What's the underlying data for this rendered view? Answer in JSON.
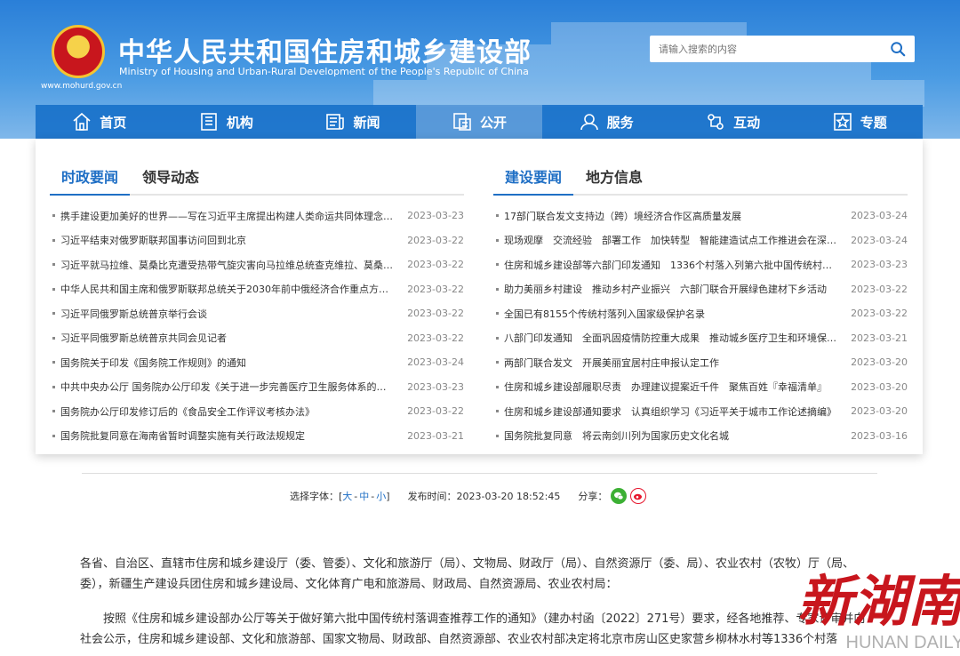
{
  "header": {
    "title_cn": "中华人民共和国住房和城乡建设部",
    "title_en": "Ministry of Housing and Urban-Rural Development of the People's Republic of China",
    "site_url": "www.mohurd.gov.cn"
  },
  "search": {
    "placeholder": "请输入搜索的内容"
  },
  "nav": [
    "首页",
    "机构",
    "新闻",
    "公开",
    "服务",
    "互动",
    "专题"
  ],
  "left": {
    "tabs": [
      "时政要闻",
      "领导动态"
    ],
    "items": [
      {
        "title": "携手建设更加美好的世界——写在习近平主席提出构建人类命运共同体理念十周年之际",
        "date": "2023-03-23"
      },
      {
        "title": "习近平结束对俄罗斯联邦国事访问回到北京",
        "date": "2023-03-22"
      },
      {
        "title": "习近平就马拉维、莫桑比克遭受热带气旋灾害向马拉维总统查克维拉、莫桑比克总统纽西致慰问电",
        "date": "2023-03-22"
      },
      {
        "title": "中华人民共和国主席和俄罗斯联邦总统关于2030年前中俄经济合作重点方向发展规划的联合声明",
        "date": "2023-03-22"
      },
      {
        "title": "习近平同俄罗斯总统普京举行会谈",
        "date": "2023-03-22"
      },
      {
        "title": "习近平同俄罗斯总统普京共同会见记者",
        "date": "2023-03-22"
      },
      {
        "title": "国务院关于印发《国务院工作规则》的通知",
        "date": "2023-03-24"
      },
      {
        "title": "中共中央办公厅 国务院办公厅印发《关于进一步完善医疗卫生服务体系的意见》",
        "date": "2023-03-23"
      },
      {
        "title": "国务院办公厅印发修订后的《食品安全工作评议考核办法》",
        "date": "2023-03-22"
      },
      {
        "title": "国务院批复同意在海南省暂时调整实施有关行政法规规定",
        "date": "2023-03-21"
      }
    ]
  },
  "right": {
    "tabs": [
      "建设要闻",
      "地方信息"
    ],
    "items": [
      {
        "title": "17部门联合发文支持边（跨）境经济合作区高质量发展",
        "date": "2023-03-24"
      },
      {
        "title": "现场观摩　交流经验　部署工作　加快转型　智能建造试点工作推进会在深圳召开",
        "date": "2023-03-24"
      },
      {
        "title": "住房和城乡建设部等六部门印发通知　1336个村落入列第六批中国传统村落名录",
        "date": "2023-03-23"
      },
      {
        "title": "助力美丽乡村建设　推动乡村产业振兴　六部门联合开展绿色建材下乡活动",
        "date": "2023-03-22"
      },
      {
        "title": "全国已有8155个传统村落列入国家级保护名录",
        "date": "2023-03-22"
      },
      {
        "title": "八部门印发通知　全面巩固疫情防控重大成果　推动城乡医疗卫生和环境保护工作补短板强弱项",
        "date": "2023-03-21"
      },
      {
        "title": "两部门联合发文　开展美丽宜居村庄申报认定工作",
        "date": "2023-03-20"
      },
      {
        "title": "住房和城乡建设部履职尽责　办理建议提案近千件　聚焦百姓『幸福清单』",
        "date": "2023-03-20"
      },
      {
        "title": "住房和城乡建设部通知要求　认真组织学习《习近平关于城市工作论述摘编》",
        "date": "2023-03-20"
      },
      {
        "title": "国务院批复同意　将云南剑川列为国家历史文化名城",
        "date": "2023-03-16"
      }
    ]
  },
  "meta": {
    "font_label": "选择字体：[",
    "font_large": "大",
    "sep1": "-",
    "font_medium": "中",
    "sep2": "-",
    "font_small": "小",
    "font_end": "]",
    "time_label": "发布时间：2023-03-20 18:52:45",
    "share_label": "分享："
  },
  "body": {
    "p1": "各省、自治区、直辖市住房和城乡建设厅（委、管委）、文化和旅游厅（局）、文物局、财政厅（局）、自然资源厅（委、局）、农业农村（农牧）厅（局、委），新疆生产建设兵团住房和城乡建设局、文化体育广电和旅游局、财政局、自然资源局、农业农村局：",
    "p2": "按照《住房和城乡建设部办公厅等关于做好第六批中国传统村落调查推荐工作的通知》（建办村函〔2022〕271号）要求，经各地推荐、专家评审并向社会公示，住房和城乡建设部、文化和旅游部、国家文物局、财政部、自然资源部、农业农村部决定将北京市房山区史家营乡柳林水村等1336个村落"
  },
  "watermark": {
    "cn": "新湖南",
    "en": "HUNAN DAILY"
  },
  "icons": {
    "search": "search-icon",
    "home": "home-icon",
    "org": "building-icon",
    "news": "news-icon",
    "open": "folder-icon",
    "service": "user-service-icon",
    "interact": "interact-icon",
    "special": "star-icon",
    "wechat": "wechat-icon",
    "weibo": "weibo-icon"
  },
  "colors": {
    "accent": "#1f6fc5",
    "header": "#2a7fd8"
  }
}
